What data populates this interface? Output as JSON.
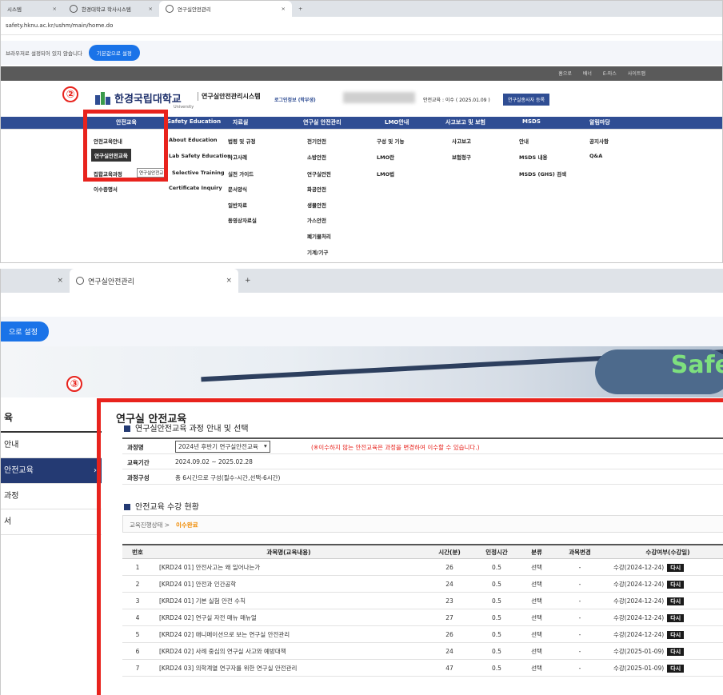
{
  "top": {
    "tabs": [
      {
        "label": "시스템"
      },
      {
        "label": "한경대학교 학사시스템"
      },
      {
        "label": "연구실안전관리"
      }
    ],
    "url": "safety.hknu.ac.kr/ushm/main/home.do",
    "infobar_text": "브라우저로 설정되어 있지 않습니다",
    "infobar_button": "기본값으로 설정",
    "util_links": [
      "홈으로",
      "배너",
      "E-마스",
      "사이트맵"
    ],
    "logo_text": "한경국립대학교",
    "logo_sub": "University",
    "system_name": "연구실안전관리시스템",
    "login_info": "로그인정보 (학부생)",
    "edu_status": "안전교육 : 이수 ( 2025.01.09 )",
    "register_button": "연구실종사자 등록",
    "nav": [
      "안전교육",
      "Safety Education",
      "자료실",
      "연구실 안전관리",
      "LMO안내",
      "사고보고 및 보험",
      "MSDS",
      "알림마당"
    ],
    "submenu": {
      "col1": [
        "안전교육안내",
        "연구실안전교육",
        "집합교육과정",
        "이수증명서"
      ],
      "tooltip": "연구실안전교",
      "col2": [
        "About Education",
        "Lab Safety Education",
        "Selective Training",
        "Certificate Inquiry"
      ],
      "col3": [
        "법령 및 규정",
        "사고사례",
        "실전 가이드",
        "문서양식",
        "일반자료",
        "동영상자료실"
      ],
      "col4": [
        "전기안전",
        "소방안전",
        "연구실안전",
        "화공안전",
        "생물안전",
        "가스안전",
        "폐기물처리",
        "기계/기구"
      ],
      "col5": [
        "구성 및 기능",
        "LMO란",
        "LMO법"
      ],
      "col6": [
        "사고보고",
        "보험청구"
      ],
      "col7": [
        "안내",
        "MSDS 내용",
        "MSDS (GHS) 검색"
      ],
      "col8": [
        "공지사항",
        "Q&A"
      ]
    },
    "marker": "②"
  },
  "bottom": {
    "tabs": [
      {
        "label": ""
      },
      {
        "label": "연구실안전관리"
      }
    ],
    "infobar_button": "으로 설정",
    "banner_text": "Safe",
    "side_title": "육",
    "side_items": [
      "안내",
      "안전교육",
      "과정",
      "서"
    ],
    "marker": "③",
    "page_title": "연구실 안전교육",
    "section1_title": "연구실안전교육 과정 안내 및 선택",
    "form": {
      "course_label": "과정명",
      "course_select": "2024년 후반기 연구실안전교육",
      "course_note": "(※이수하지 않는 안전교육은 과정을 변경하여 이수할 수 있습니다.)",
      "period_label": "교육기간",
      "period_value": "2024.09.02 ~ 2025.02.28",
      "compose_label": "과정구성",
      "compose_value": "총 6시간으로 구성(필수-시간,선택-6시간)"
    },
    "section2_title": "안전교육 수강 현황",
    "progress_prefix": "교육진행상태 >",
    "progress_status": "이수완료",
    "table": {
      "headers": [
        "번호",
        "과목명(교육내용)",
        "시간(분)",
        "인정시간",
        "분류",
        "과목변경",
        "수강여부(수강일)"
      ],
      "rows": [
        {
          "no": "1",
          "title": "[KRD24 01] 안전사고는 왜 일어나는가",
          "min": "26",
          "credit": "0.5",
          "type": "선택",
          "change": "-",
          "status": "수강(2024-12-24)",
          "btn": "다시"
        },
        {
          "no": "2",
          "title": "[KRD24 01] 안전과 인간공학",
          "min": "24",
          "credit": "0.5",
          "type": "선택",
          "change": "-",
          "status": "수강(2024-12-24)",
          "btn": "다시"
        },
        {
          "no": "3",
          "title": "[KRD24 01] 기본 실험 안전 수칙",
          "min": "23",
          "credit": "0.5",
          "type": "선택",
          "change": "-",
          "status": "수강(2024-12-24)",
          "btn": "다시"
        },
        {
          "no": "4",
          "title": "[KRD24 02] 연구실 자전 매뉴 매뉴얼",
          "min": "27",
          "credit": "0.5",
          "type": "선택",
          "change": "-",
          "status": "수강(2024-12-24)",
          "btn": "다시"
        },
        {
          "no": "5",
          "title": "[KRD24 02] 애니메이션으로 보는 연구실 안전관리",
          "min": "26",
          "credit": "0.5",
          "type": "선택",
          "change": "-",
          "status": "수강(2024-12-24)",
          "btn": "다시"
        },
        {
          "no": "6",
          "title": "[KRD24 02] 사례 중심의 연구실 사고와 예방대책",
          "min": "24",
          "credit": "0.5",
          "type": "선택",
          "change": "-",
          "status": "수강(2025-01-09)",
          "btn": "다시"
        },
        {
          "no": "7",
          "title": "[KRD24 03] 의학계열 연구자를 위한 연구실 안전관리",
          "min": "47",
          "credit": "0.5",
          "type": "선택",
          "change": "-",
          "status": "수강(2025-01-09)",
          "btn": "다시"
        }
      ]
    }
  },
  "colors": {
    "nav_blue": "#2f4d93",
    "highlight_red": "#e8231d",
    "side_active": "#243a73",
    "note_red": "#e8231d",
    "status_orange": "#f08a00"
  }
}
